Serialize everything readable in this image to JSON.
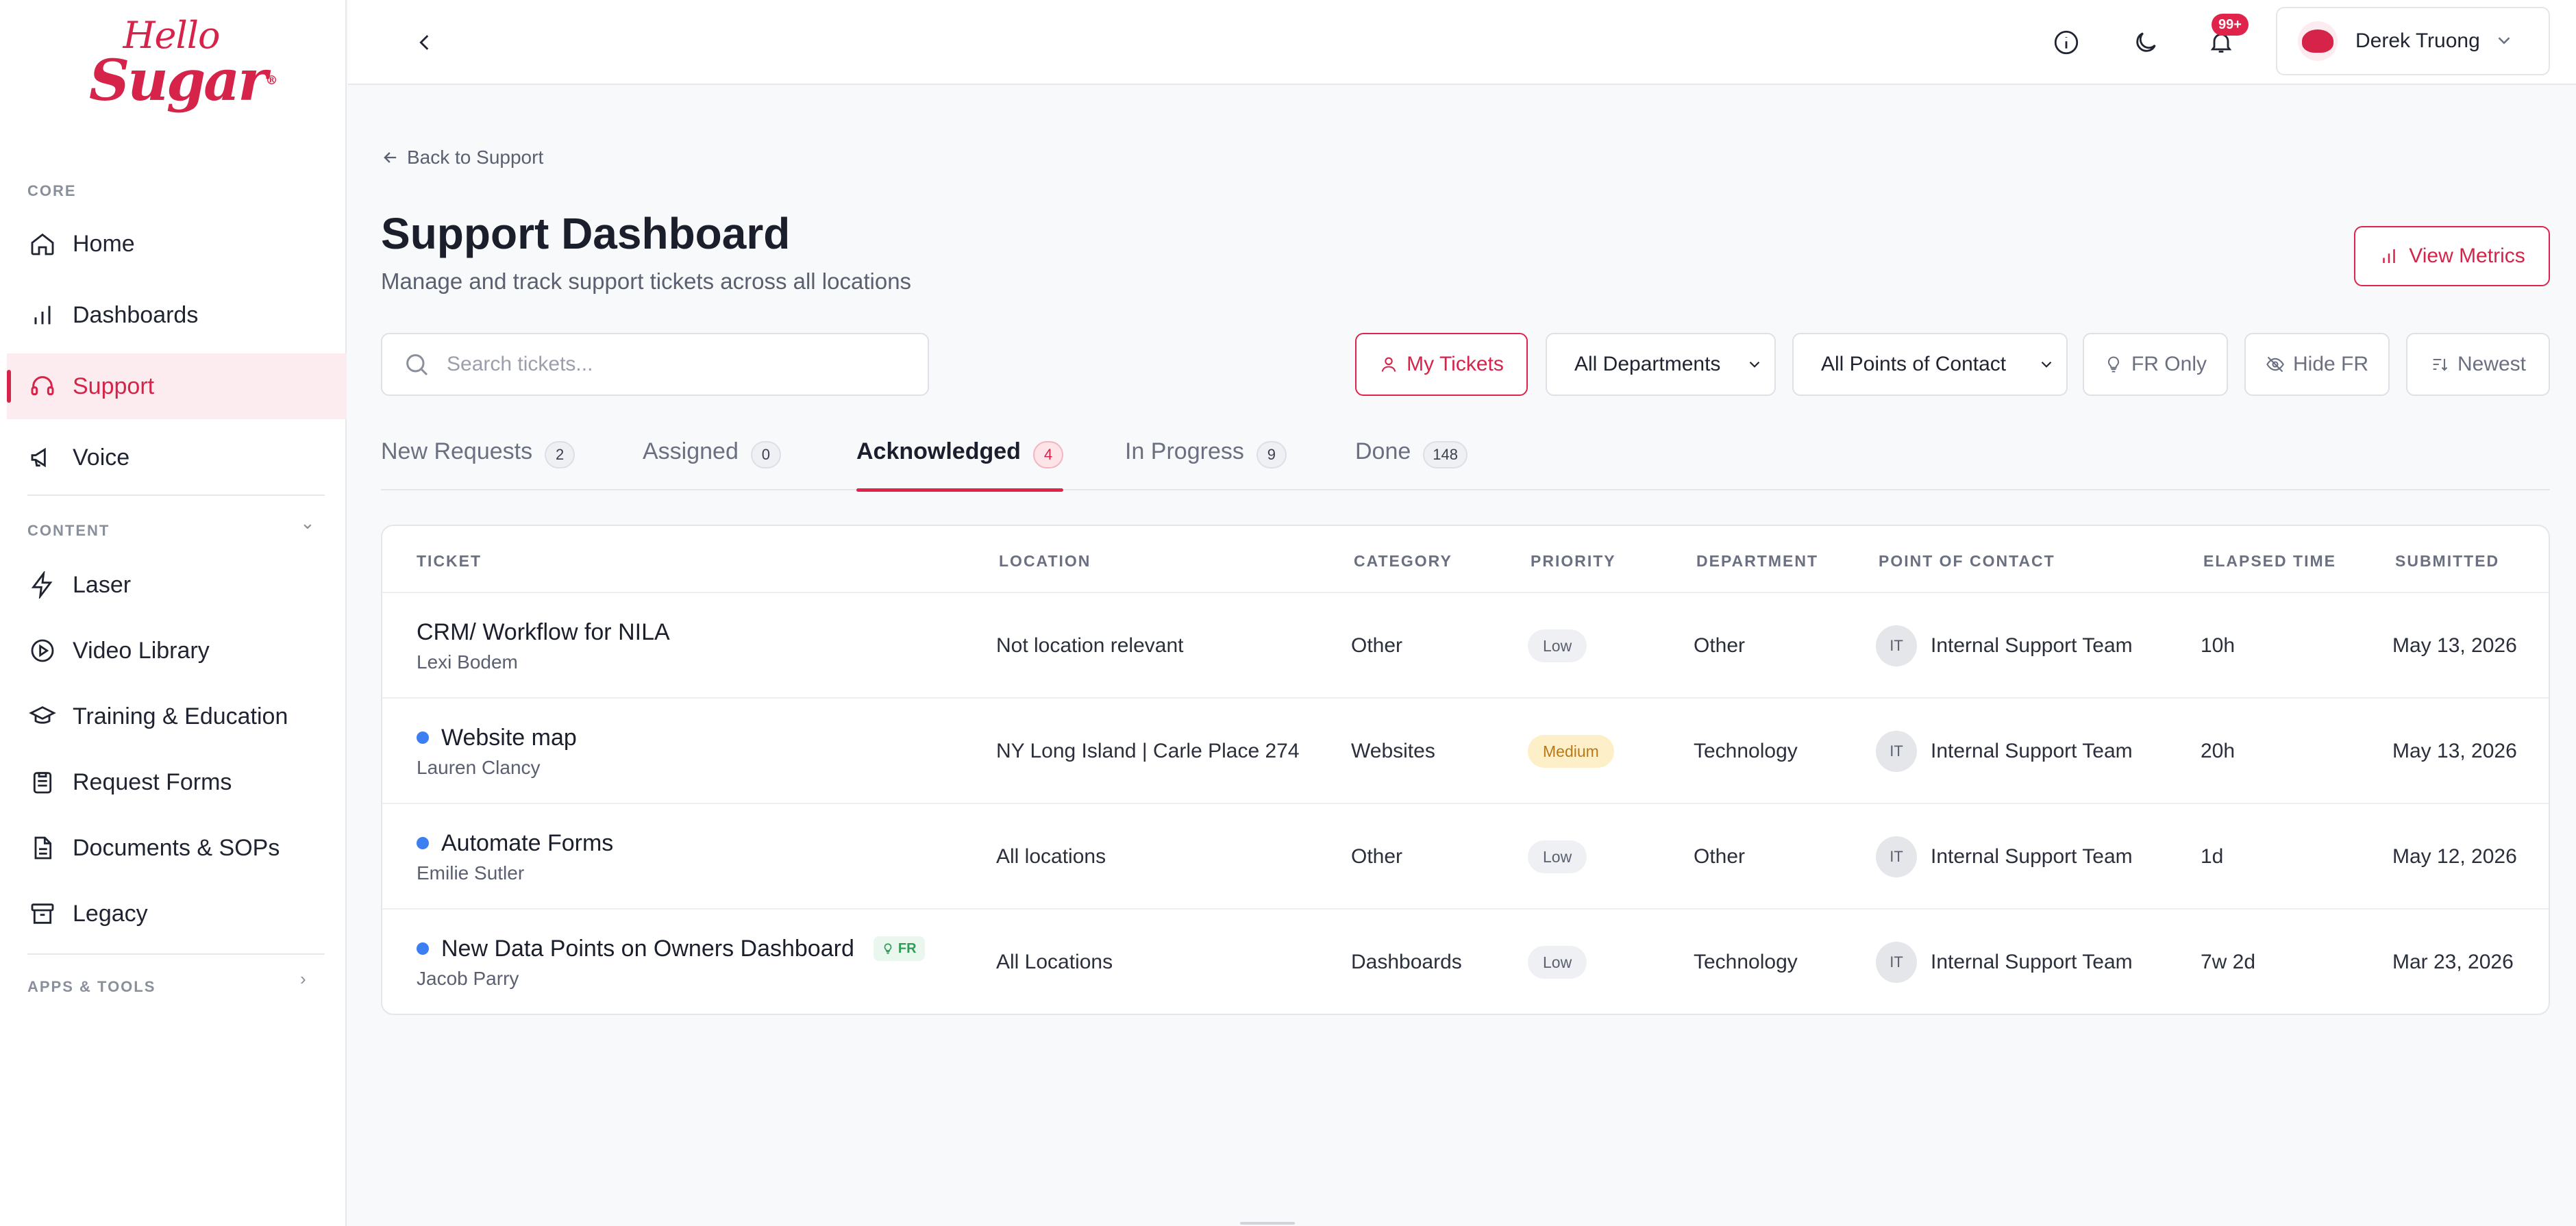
{
  "brand": {
    "line1": "Hello",
    "line2": "Sugar",
    "reg": "®"
  },
  "sidebar": {
    "core_label": "CORE",
    "content_label": "CONTENT",
    "apps_label": "APPS & TOOLS",
    "core_items": [
      {
        "label": "Home",
        "icon": "home-icon"
      },
      {
        "label": "Dashboards",
        "icon": "bar-chart-icon"
      },
      {
        "label": "Support",
        "icon": "headset-icon",
        "active": true
      },
      {
        "label": "Voice",
        "icon": "megaphone-icon"
      }
    ],
    "content_items": [
      {
        "label": "Laser",
        "icon": "lightning-icon"
      },
      {
        "label": "Video Library",
        "icon": "play-circle-icon"
      },
      {
        "label": "Training & Education",
        "icon": "graduation-cap-icon"
      },
      {
        "label": "Request Forms",
        "icon": "clipboard-icon"
      },
      {
        "label": "Documents & SOPs",
        "icon": "document-icon"
      },
      {
        "label": "Legacy",
        "icon": "archive-icon"
      }
    ]
  },
  "topbar": {
    "notification_badge": "99+",
    "user_name": "Derek Truong"
  },
  "header": {
    "back_link": "Back to Support",
    "title": "Support Dashboard",
    "subtitle": "Manage and track support tickets across all locations",
    "metrics_button": "View Metrics"
  },
  "filters": {
    "search_placeholder": "Search tickets...",
    "my_tickets": "My Tickets",
    "departments": "All Departments",
    "points_of_contact": "All Points of Contact",
    "fr_only": "FR Only",
    "hide_fr": "Hide FR",
    "sort": "Newest"
  },
  "tabs": [
    {
      "label": "New Requests",
      "count": "2"
    },
    {
      "label": "Assigned",
      "count": "0"
    },
    {
      "label": "Acknowledged",
      "count": "4",
      "active": true
    },
    {
      "label": "In Progress",
      "count": "9"
    },
    {
      "label": "Done",
      "count": "148"
    }
  ],
  "table": {
    "columns": [
      "TICKET",
      "LOCATION",
      "CATEGORY",
      "PRIORITY",
      "DEPARTMENT",
      "POINT OF CONTACT",
      "ELAPSED TIME",
      "SUBMITTED"
    ],
    "rows": [
      {
        "title": "CRM/ Workflow for NILA",
        "author": "Lexi Bodem",
        "unread": false,
        "fr": false,
        "location": "Not location relevant",
        "category": "Other",
        "priority": "Low",
        "department": "Other",
        "poc_initials": "IT",
        "poc": "Internal Support Team",
        "elapsed": "10h",
        "submitted": "May 13, 2026"
      },
      {
        "title": "Website map",
        "author": "Lauren Clancy",
        "unread": true,
        "fr": false,
        "location": "NY Long Island | Carle Place 274",
        "category": "Websites",
        "priority": "Medium",
        "department": "Technology",
        "poc_initials": "IT",
        "poc": "Internal Support Team",
        "elapsed": "20h",
        "submitted": "May 13, 2026"
      },
      {
        "title": "Automate Forms",
        "author": "Emilie Sutler",
        "unread": true,
        "fr": false,
        "location": "All locations",
        "category": "Other",
        "priority": "Low",
        "department": "Other",
        "poc_initials": "IT",
        "poc": "Internal Support Team",
        "elapsed": "1d",
        "submitted": "May 12, 2026"
      },
      {
        "title": "New Data Points on Owners Dashboard",
        "author": "Jacob Parry",
        "unread": true,
        "fr": true,
        "fr_label": "FR",
        "location": "All Locations",
        "category": "Dashboards",
        "priority": "Low",
        "department": "Technology",
        "poc_initials": "IT",
        "poc": "Internal Support Team",
        "elapsed": "7w 2d",
        "submitted": "Mar 23, 2026"
      }
    ]
  },
  "colors": {
    "accent": "#d6234a",
    "unread_dot": "#3b7ff2",
    "medium": "#fdf0c9"
  }
}
